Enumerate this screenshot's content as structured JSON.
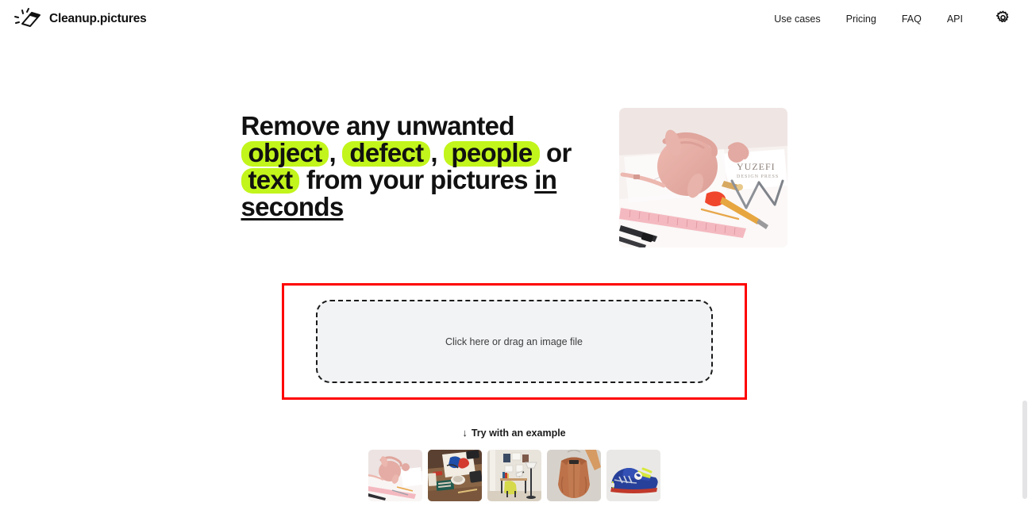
{
  "brand": {
    "name": "Cleanup.pictures",
    "logo_icon": "eraser-icon"
  },
  "nav": {
    "links": [
      {
        "label": "Use cases"
      },
      {
        "label": "Pricing"
      },
      {
        "label": "FAQ"
      },
      {
        "label": "API"
      }
    ],
    "settings_icon": "gear-icon"
  },
  "hero": {
    "headline": {
      "segment_1": "Remove any unwanted",
      "highlight_1": "object",
      "separator_1": ",",
      "highlight_2": "defect",
      "separator_2": ",",
      "highlight_3": "people",
      "connector": "or",
      "highlight_4": "text",
      "segment_2": "from your pictures",
      "underlined": "in seconds"
    },
    "image_alt": "pink-handbag-on-desk-photo"
  },
  "dropzone": {
    "label": "Click here or drag an image file",
    "highlight_color": "#ff0000",
    "fill_color": "#f2f3f5"
  },
  "examples": {
    "arrow_icon": "↓",
    "title": "Try with an example",
    "items": [
      {
        "alt": "pink-handbag-example"
      },
      {
        "alt": "desk-with-supplies-example"
      },
      {
        "alt": "room-with-desk-and-lamp-example"
      },
      {
        "alt": "brown-jacket-example"
      },
      {
        "alt": "blue-sneaker-example"
      }
    ]
  },
  "theme": {
    "highlight_green": "#c2f51b",
    "text_color": "#111111",
    "annotation_red": "#ff0000"
  }
}
